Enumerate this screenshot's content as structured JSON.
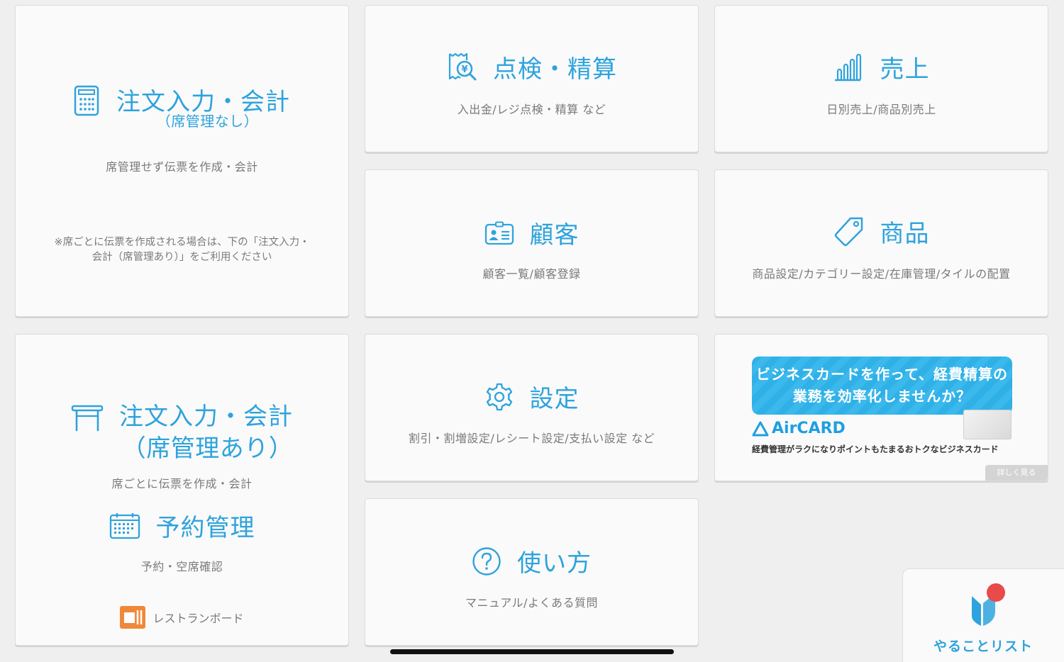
{
  "tiles": {
    "order_no_seat": {
      "title": "注文入力・会計",
      "subtitle": "（席管理なし）",
      "description": "席管理せず伝票を作成・会計",
      "note_line1": "※席ごとに伝票を作成される場合は、下の「注文入力・",
      "note_line2": "会計（席管理あり）」をご利用ください"
    },
    "inspection": {
      "title": "点検・精算",
      "description": "入出金/レジ点検・精算 など"
    },
    "sales": {
      "title": "売上",
      "description": "日別売上/商品別売上"
    },
    "customers": {
      "title": "顧客",
      "description": "顧客一覧/顧客登録"
    },
    "products": {
      "title": "商品",
      "description": "商品設定/カテゴリー設定/在庫管理/タイルの配置"
    },
    "order_with_seat": {
      "title": "注文入力・会計",
      "subtitle": "（席管理あり）",
      "description": "席ごとに伝票を作成・会計",
      "reservation_title": "予約管理",
      "reservation_description": "予約・空席確認",
      "restaurant_board": "レストランボード"
    },
    "settings": {
      "title": "設定",
      "description": "割引・割増設定/レシート設定/支払い設定 など"
    },
    "help": {
      "title": "使い方",
      "description": "マニュアル/よくある質問"
    },
    "ad": {
      "banner_line1": "ビジネスカードを作って、経費精算の",
      "banner_line2": "業務を効率化しませんか？",
      "logo": "AirCARD",
      "tagline": "経費管理がラクになりポイントもたまるおトクなビジネスカード",
      "more": "詳しく見る"
    }
  },
  "todo": {
    "label": "やることリスト",
    "has_notification": true
  },
  "colors": {
    "accent": "#2ea3dd",
    "background": "#efefef",
    "tile": "#fafafa",
    "notification": "#e94a4a",
    "restaurant_board": "#f0883a"
  }
}
